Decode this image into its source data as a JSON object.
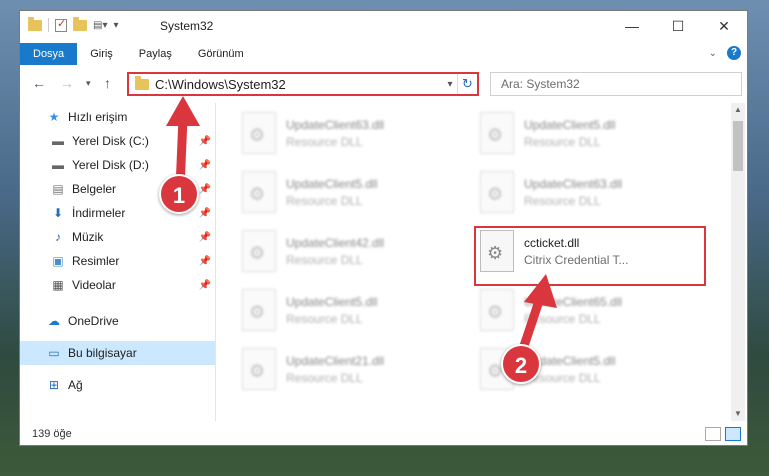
{
  "window": {
    "title": "System32"
  },
  "ribbon": {
    "tabs": [
      "Dosya",
      "Giriş",
      "Paylaş",
      "Görünüm"
    ],
    "active_tab": "Dosya",
    "accent": "#1979ca"
  },
  "address": {
    "path": "C:\\Windows\\System32",
    "search_placeholder": "Ara: System32"
  },
  "nav": {
    "items": [
      {
        "label": "Hızlı erişim",
        "icon": "star-icon"
      },
      {
        "label": "Yerel Disk (C:)",
        "icon": "drive-icon",
        "pinned": true
      },
      {
        "label": "Yerel Disk (D:)",
        "icon": "drive-icon",
        "pinned": true
      },
      {
        "label": "Belgeler",
        "icon": "document-icon",
        "pinned": true
      },
      {
        "label": "İndirmeler",
        "icon": "download-icon",
        "pinned": true
      },
      {
        "label": "Müzik",
        "icon": "music-icon",
        "pinned": true
      },
      {
        "label": "Resimler",
        "icon": "pictures-icon",
        "pinned": true
      },
      {
        "label": "Videolar",
        "icon": "video-icon",
        "pinned": true
      },
      {
        "label": "OneDrive",
        "icon": "cloud-icon"
      },
      {
        "label": "Bu bilgisayar",
        "icon": "computer-icon",
        "selected": true
      },
      {
        "label": "Ağ",
        "icon": "network-icon"
      }
    ]
  },
  "files": [
    {
      "name": "UpdateClient63.dll",
      "desc": "Resource DLL",
      "blurred": true
    },
    {
      "name": "UpdateClient5.dll",
      "desc": "Resource DLL",
      "blurred": true
    },
    {
      "name": "UpdateClient5.dll",
      "desc": "Resource DLL",
      "blurred": true
    },
    {
      "name": "UpdateClient63.dll",
      "desc": "Resource DLL",
      "blurred": true
    },
    {
      "name": "UpdateClient42.dll",
      "desc": "Resource DLL",
      "blurred": true
    },
    {
      "name": "ccticket.dll",
      "desc": "Citrix Credential T...",
      "blurred": false
    },
    {
      "name": "UpdateClient5.dll",
      "desc": "Resource DLL",
      "blurred": true
    },
    {
      "name": "UpdateClient65.dll",
      "desc": "Resource DLL",
      "blurred": true
    },
    {
      "name": "UpdateClient21.dll",
      "desc": "Resource DLL",
      "blurred": true
    },
    {
      "name": "UpdateClient5.dll",
      "desc": "Resource DLL",
      "blurred": true
    }
  ],
  "status": {
    "count": "139 öğe"
  },
  "annotations": {
    "step1": "1",
    "step2": "2",
    "color": "#d9363e"
  }
}
